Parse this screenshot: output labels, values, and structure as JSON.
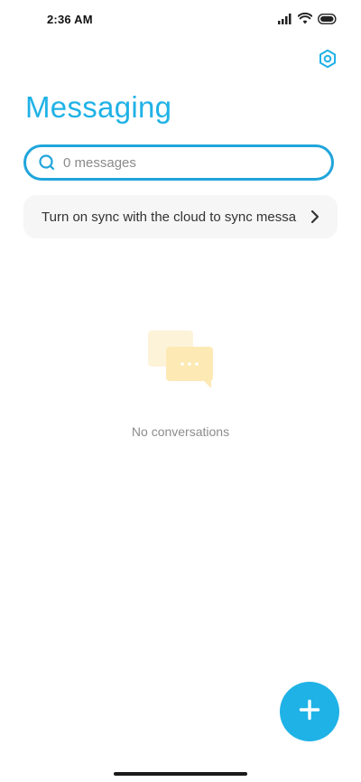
{
  "status_bar": {
    "time": "2:36 AM",
    "icons": [
      "signal-icon",
      "wifi-icon",
      "battery-icon"
    ]
  },
  "header": {
    "title": "Messaging",
    "settings_icon": "settings-icon"
  },
  "search": {
    "placeholder": "0 messages",
    "value": "",
    "icon": "search-icon"
  },
  "sync_banner": {
    "text": "Turn on sync with the cloud to sync messa",
    "icon": "chevron-right-icon"
  },
  "empty_state": {
    "illustration": "chat-bubbles-icon",
    "text": "No conversations"
  },
  "fab": {
    "icon": "plus-icon"
  },
  "colors": {
    "accent": "#1fb2e6",
    "search_border": "#1fa5db",
    "card_bg": "#f6f6f6",
    "muted_text": "#8c8c8c",
    "illustration": "#fde9b4"
  }
}
